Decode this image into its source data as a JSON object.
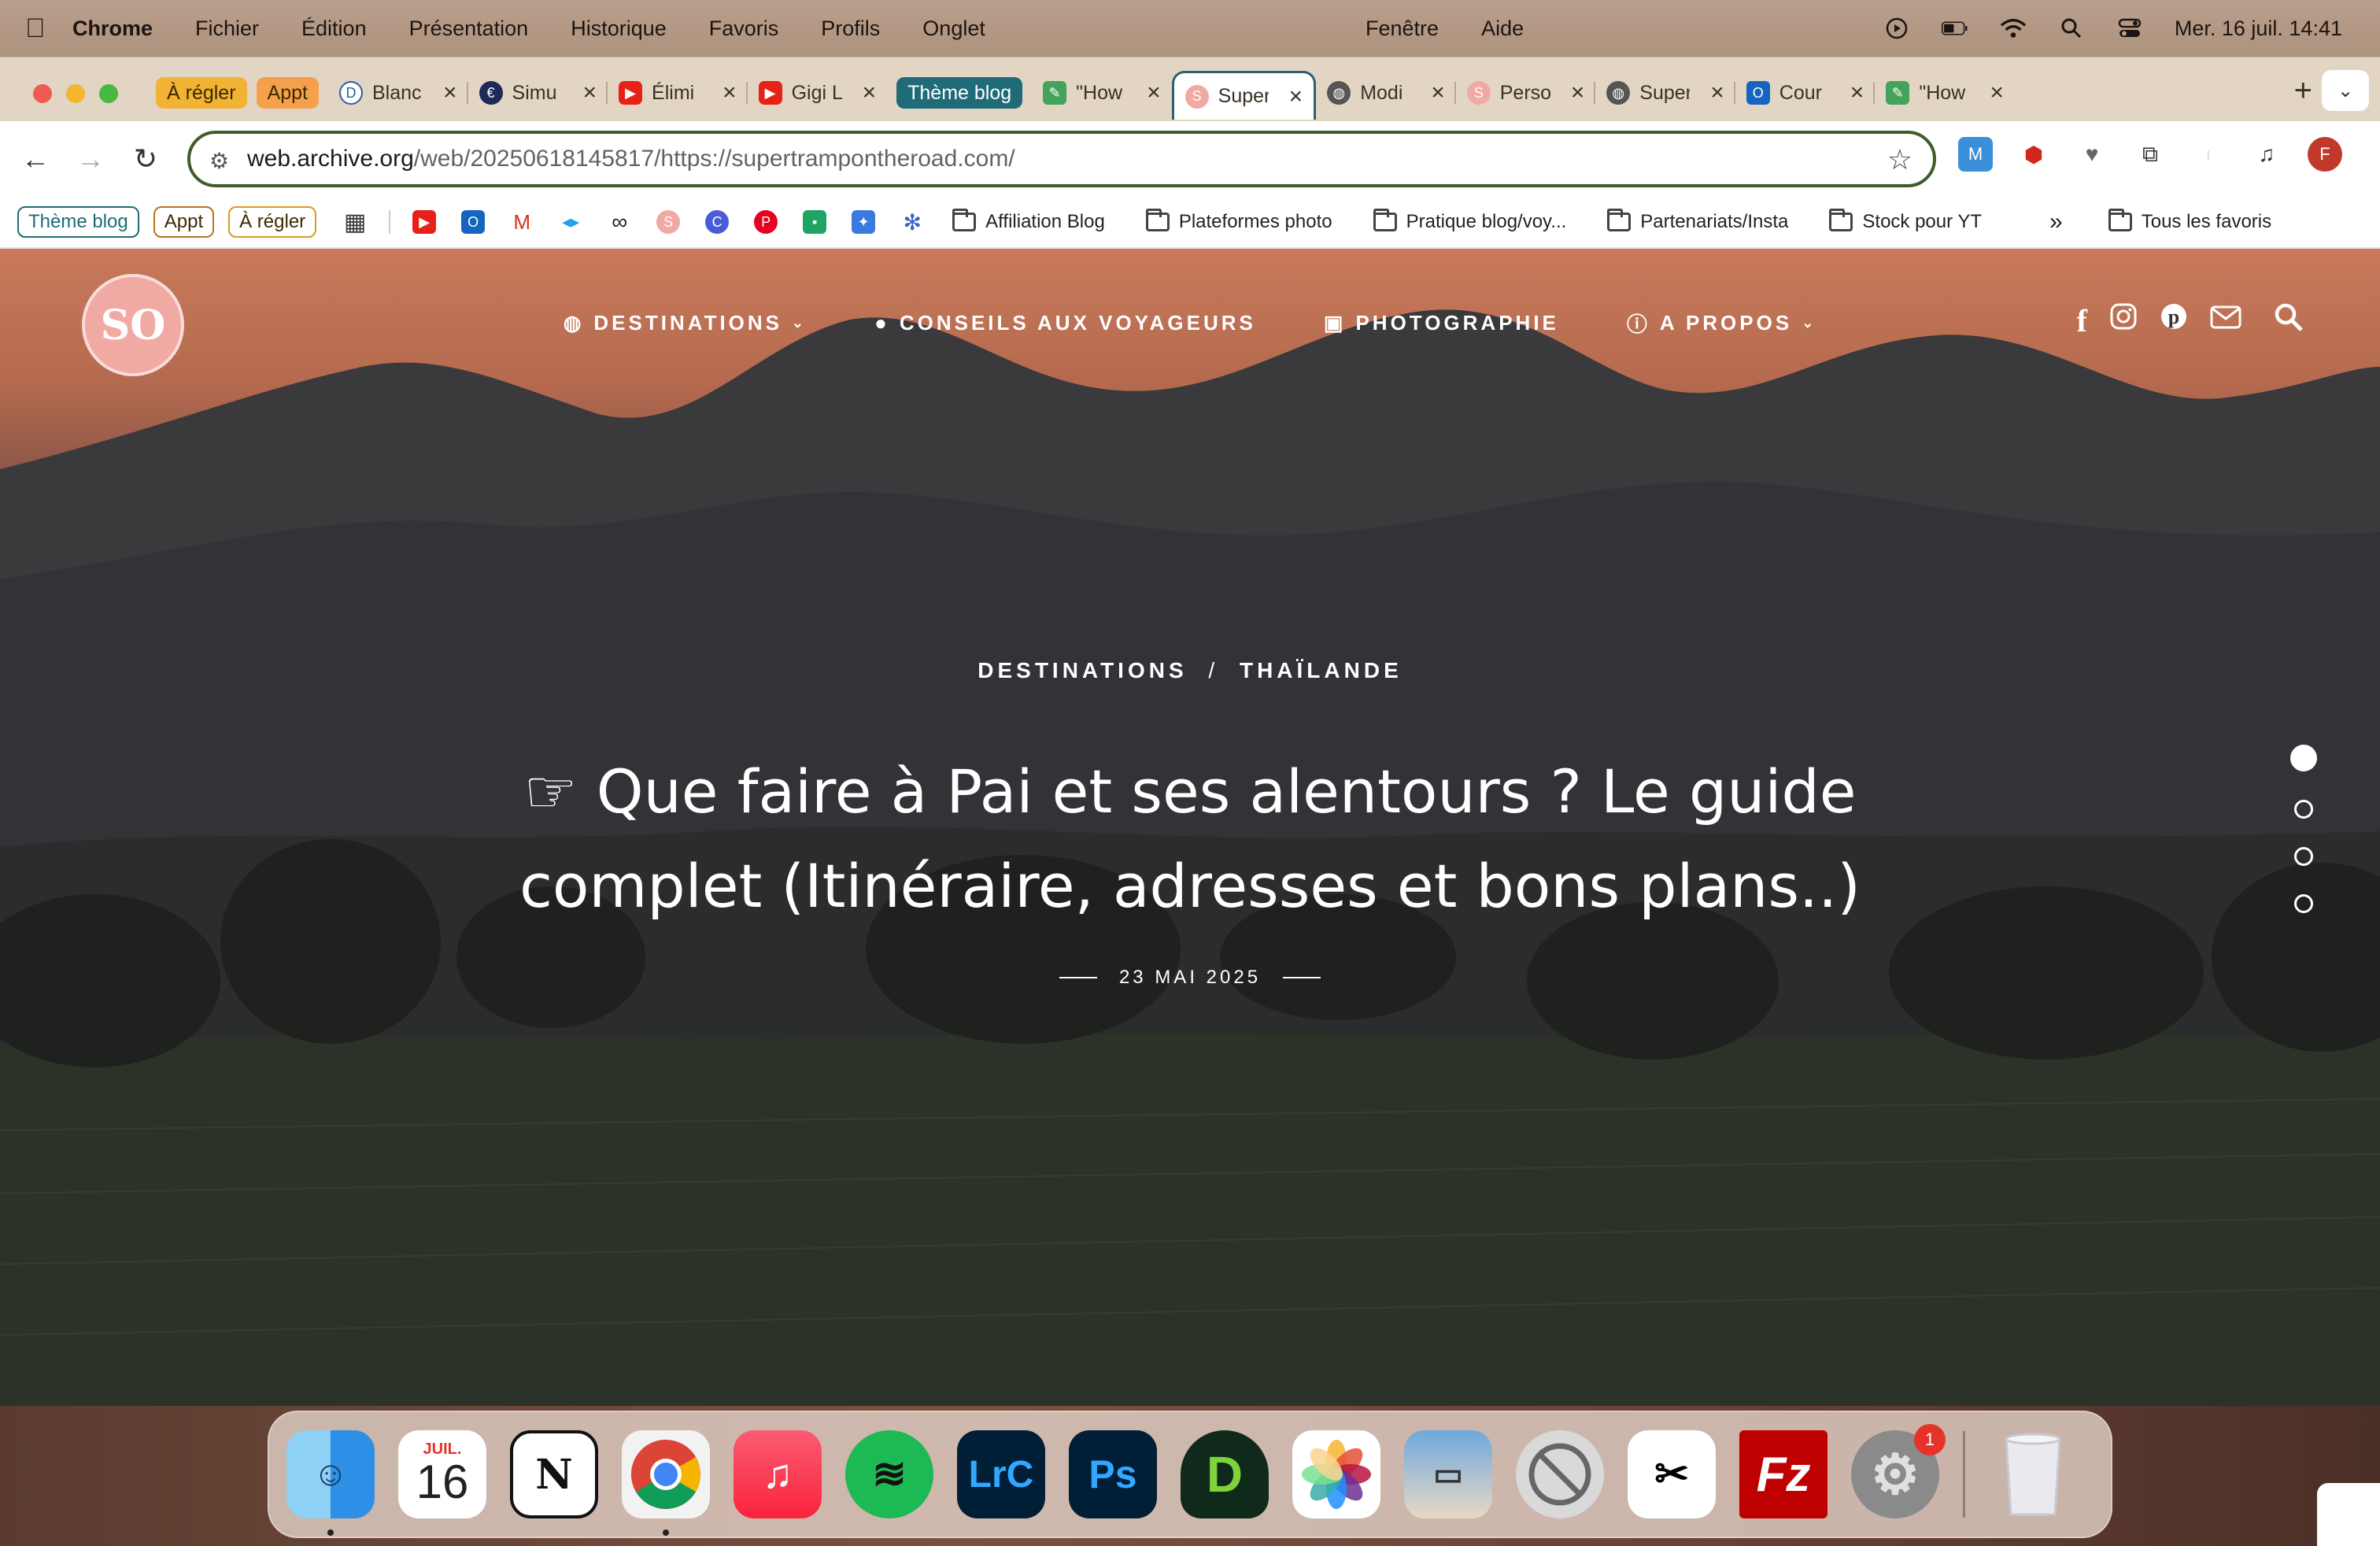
{
  "menubar": {
    "app_name": "Chrome",
    "items": [
      "Fichier",
      "Édition",
      "Présentation",
      "Historique",
      "Favoris",
      "Profils",
      "Onglet"
    ],
    "center_items": [
      "Fenêtre",
      "Aide"
    ],
    "datetime": "Mer. 16 juil.  14:41"
  },
  "tabs": {
    "groups": [
      {
        "label": "À régler",
        "color": "#f2b233"
      },
      {
        "label": "Appt",
        "color": "#f5a04a"
      },
      {
        "label": "Thème blog",
        "color": "#1f6b78"
      }
    ],
    "items": [
      {
        "title": "Blanc",
        "icon": "disney-icon",
        "color": "#2c5f9e"
      },
      {
        "title": "Simu",
        "icon": "simulator-icon",
        "color": "#1e2a57"
      },
      {
        "title": "Élimi",
        "icon": "youtube-icon",
        "color": "#e62117"
      },
      {
        "title": "Gigi L",
        "icon": "youtube-icon",
        "color": "#e62117"
      },
      {
        "title": "\"How",
        "icon": "pen-icon",
        "color": "#43a35a"
      },
      {
        "title": "Super",
        "icon": "blog-icon",
        "color": "#f1a9a3"
      },
      {
        "title": "Modi",
        "icon": "globe-icon",
        "color": "#555555"
      },
      {
        "title": "Perso",
        "icon": "blog-icon",
        "color": "#f1a9a3"
      },
      {
        "title": "Super",
        "icon": "globe-icon",
        "color": "#555555"
      },
      {
        "title": "Cour",
        "icon": "outlook-icon",
        "color": "#1565c0"
      },
      {
        "title": "\"How",
        "icon": "pen-icon",
        "color": "#43a35a"
      }
    ]
  },
  "toolbar": {
    "url_host": "web.archive.org",
    "url_path": "/web/20250618145817/https://supertrampontheroad.com/"
  },
  "bookmarks": {
    "pills": [
      {
        "label": "Thème blog",
        "color": "#1f6b78"
      },
      {
        "label": "Appt",
        "color": "#f5a04a"
      },
      {
        "label": "À régler",
        "color": "#d89b1d"
      }
    ],
    "folders": [
      "Affiliation Blog",
      "Plateformes photo",
      "Pratique blog/voy...",
      "Partenariats/Insta",
      "Stock pour YT"
    ],
    "all_bookmarks": "Tous les favoris"
  },
  "site": {
    "logo_text": "SO",
    "nav": [
      {
        "label": "DESTINATIONS",
        "icon": "globe-icon",
        "has_dropdown": true
      },
      {
        "label": "CONSEILS AUX VOYAGEURS",
        "icon": "speech-bubble-icon",
        "has_dropdown": false
      },
      {
        "label": "PHOTOGRAPHIE",
        "icon": "camera-icon",
        "has_dropdown": false
      },
      {
        "label": "A PROPOS",
        "icon": "info-icon",
        "has_dropdown": true
      }
    ],
    "breadcrumb_1": "DESTINATIONS",
    "breadcrumb_sep": "/",
    "breadcrumb_2": "THAÏLANDE",
    "headline": "☞ Que faire à Pai et ses alentours ? Le guide complet (Itinéraire, adresses et bons plans..)",
    "date": "23 MAI 2025",
    "slider": {
      "total": 4,
      "active": 1
    }
  },
  "dock": {
    "calendar_month": "JUIL.",
    "calendar_day": "16",
    "settings_badge": "1"
  }
}
